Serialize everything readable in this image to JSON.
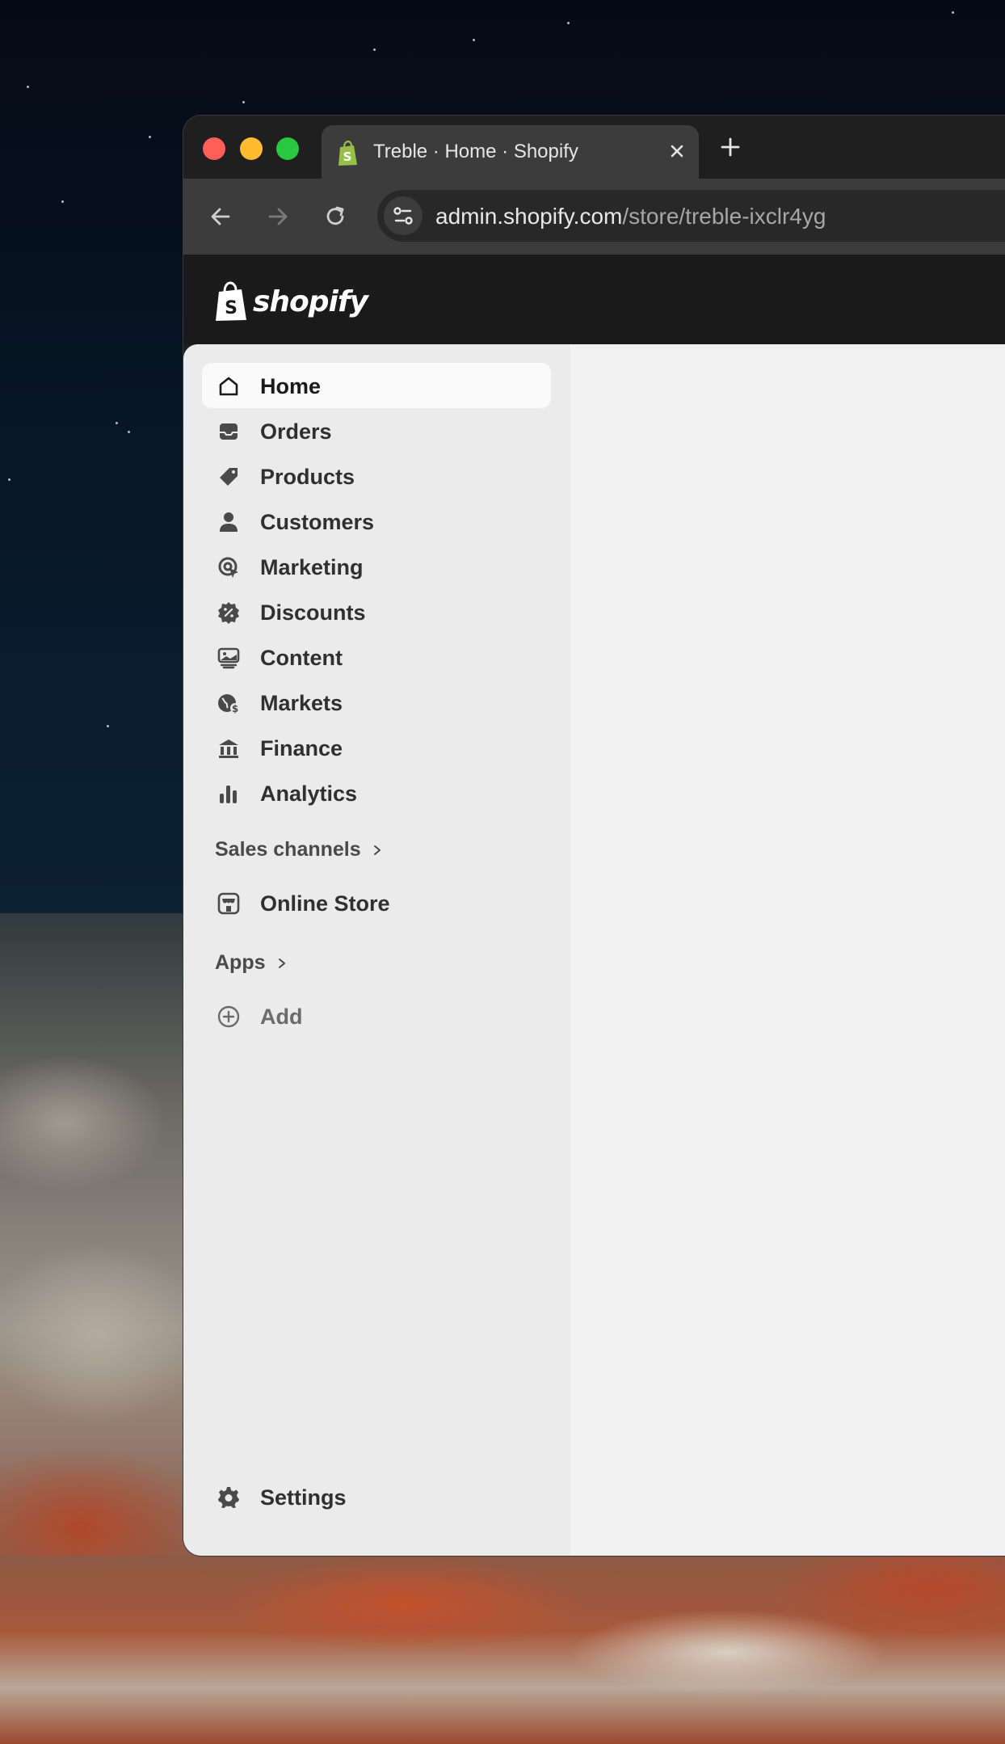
{
  "browser": {
    "tab_title": "Treble · Home · Shopify",
    "url_host": "admin.shopify.com",
    "url_path": "/store/treble-ixclr4yg"
  },
  "brand": {
    "logo_text": "shopify",
    "accent": "#95bf47",
    "topbar_color": "#1a1a1a"
  },
  "sidebar": {
    "items": [
      {
        "label": "Home",
        "icon": "home-icon",
        "active": true
      },
      {
        "label": "Orders",
        "icon": "inbox-icon"
      },
      {
        "label": "Products",
        "icon": "tag-icon"
      },
      {
        "label": "Customers",
        "icon": "person-icon"
      },
      {
        "label": "Marketing",
        "icon": "target-icon"
      },
      {
        "label": "Discounts",
        "icon": "discount-badge-icon"
      },
      {
        "label": "Content",
        "icon": "image-content-icon"
      },
      {
        "label": "Markets",
        "icon": "globe-icon"
      },
      {
        "label": "Finance",
        "icon": "bank-icon"
      },
      {
        "label": "Analytics",
        "icon": "bar-chart-icon"
      }
    ],
    "sales_channels": {
      "heading": "Sales channels",
      "items": [
        {
          "label": "Online Store",
          "icon": "store-icon"
        }
      ]
    },
    "apps": {
      "heading": "Apps",
      "add_label": "Add"
    },
    "settings_label": "Settings"
  }
}
